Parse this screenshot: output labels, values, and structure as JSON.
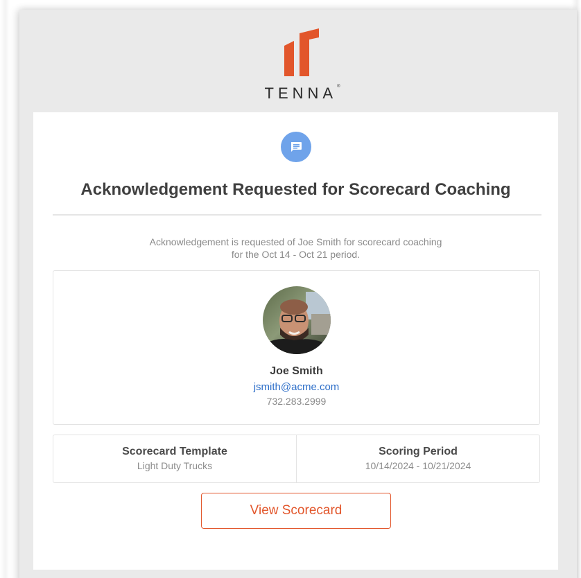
{
  "brand": {
    "name": "TENNA",
    "trademark": "®",
    "accent_color": "#e2562b",
    "logo_icon": "tenna-logo-icon"
  },
  "notification": {
    "icon": "chat-message-icon",
    "icon_color": "#6fa3ea",
    "title": "Acknowledgement Requested for Scorecard Coaching",
    "intro_line1": "Acknowledgement is requested of Joe Smith for scorecard coaching",
    "intro_line2": "for the Oct 14 - Oct 21 period."
  },
  "person": {
    "name": "Joe Smith",
    "email": "jsmith@acme.com",
    "phone": "732.283.2999",
    "link_color": "#2e6fc9"
  },
  "details": {
    "template_label": "Scorecard Template",
    "template_value": "Light Duty Trucks",
    "period_label": "Scoring Period",
    "period_value": "10/14/2024 - 10/21/2024"
  },
  "actions": {
    "view_label": "View Scorecard"
  }
}
